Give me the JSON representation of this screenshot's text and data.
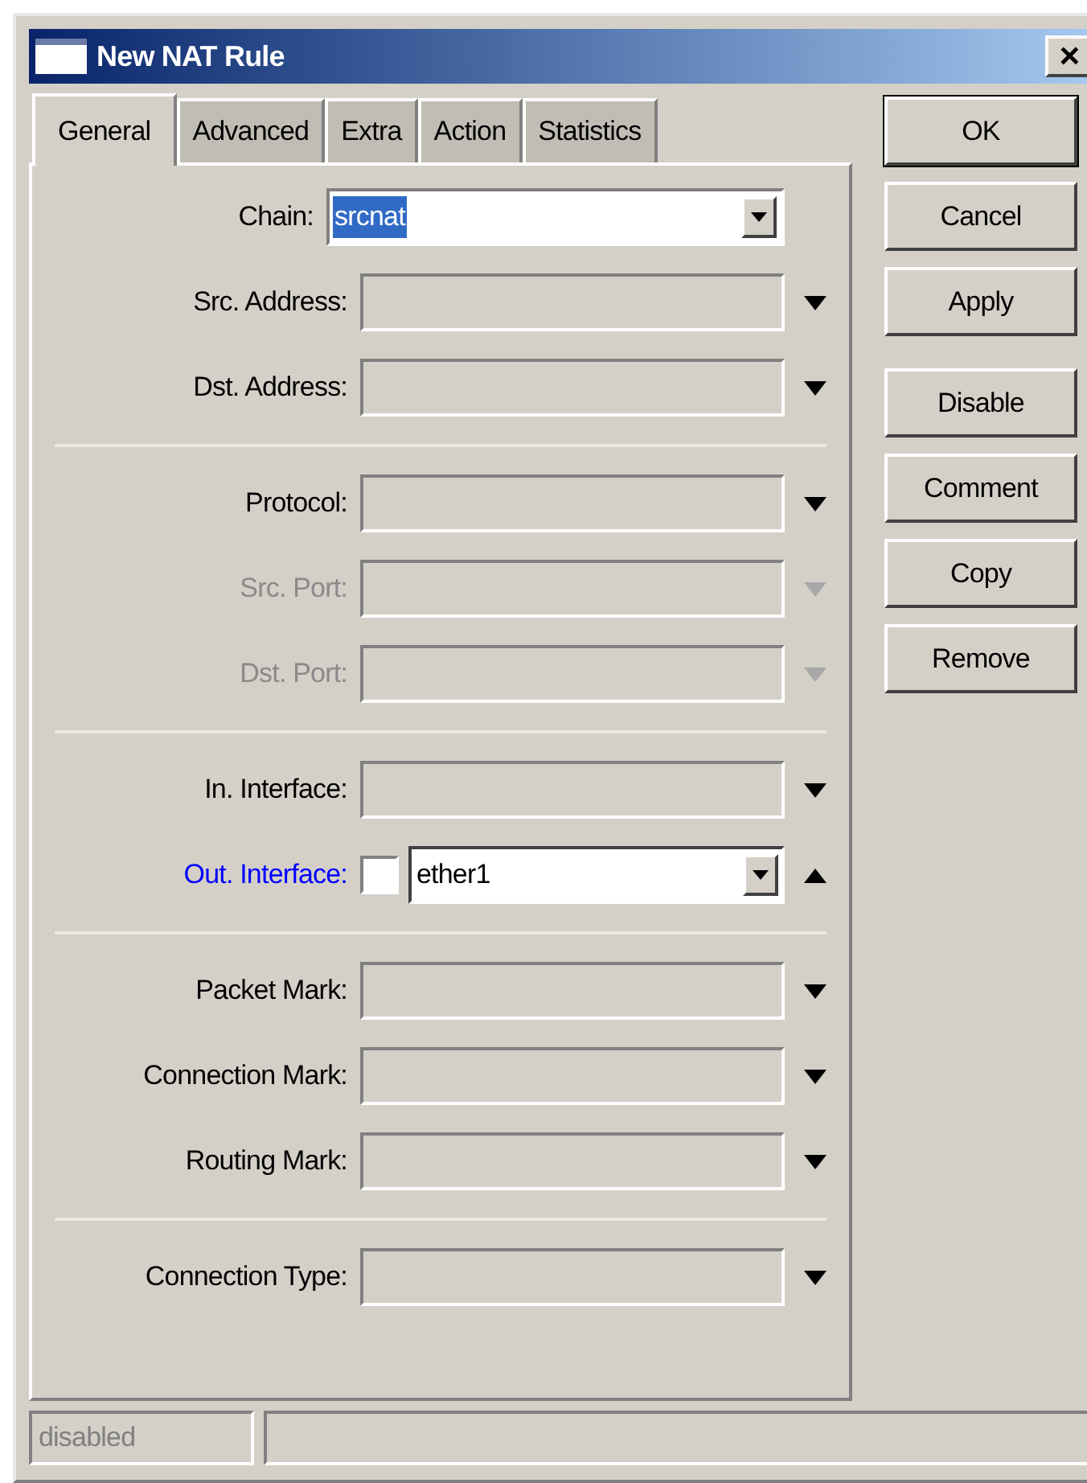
{
  "window": {
    "title": "New NAT Rule",
    "close": "×"
  },
  "tabs": [
    {
      "label": "General",
      "selected": true
    },
    {
      "label": "Advanced",
      "selected": false
    },
    {
      "label": "Extra",
      "selected": false
    },
    {
      "label": "Action",
      "selected": false
    },
    {
      "label": "Statistics",
      "selected": false
    }
  ],
  "sections": [
    [
      {
        "label": "Chain:",
        "kind": "combo",
        "value": "srcnat",
        "highlighted": true
      },
      {
        "label": "Src. Address:",
        "kind": "field",
        "disabled": false,
        "expanded": false
      },
      {
        "label": "Dst. Address:",
        "kind": "field",
        "disabled": false,
        "expanded": false
      }
    ],
    [
      {
        "label": "Protocol:",
        "kind": "field",
        "disabled": false,
        "expanded": false
      },
      {
        "label": "Src. Port:",
        "kind": "field",
        "disabled": true,
        "expanded": false
      },
      {
        "label": "Dst. Port:",
        "kind": "field",
        "disabled": true,
        "expanded": false
      }
    ],
    [
      {
        "label": "In. Interface:",
        "kind": "field",
        "disabled": false,
        "expanded": false
      },
      {
        "label": "Out. Interface:",
        "kind": "checkbox-combo",
        "checked": false,
        "value": "ether1",
        "expanded": true
      }
    ],
    [
      {
        "label": "Packet Mark:",
        "kind": "field",
        "disabled": false,
        "expanded": false
      },
      {
        "label": "Connection Mark:",
        "kind": "field",
        "disabled": false,
        "expanded": false
      },
      {
        "label": "Routing Mark:",
        "kind": "field",
        "disabled": false,
        "expanded": false
      }
    ],
    [
      {
        "label": "Connection Type:",
        "kind": "field",
        "disabled": false,
        "expanded": false
      }
    ]
  ],
  "buttons": [
    [
      "OK",
      "Cancel",
      "Apply"
    ],
    [
      "Disable",
      "Comment",
      "Copy",
      "Remove"
    ]
  ],
  "status_bar": {
    "status": "disabled"
  }
}
